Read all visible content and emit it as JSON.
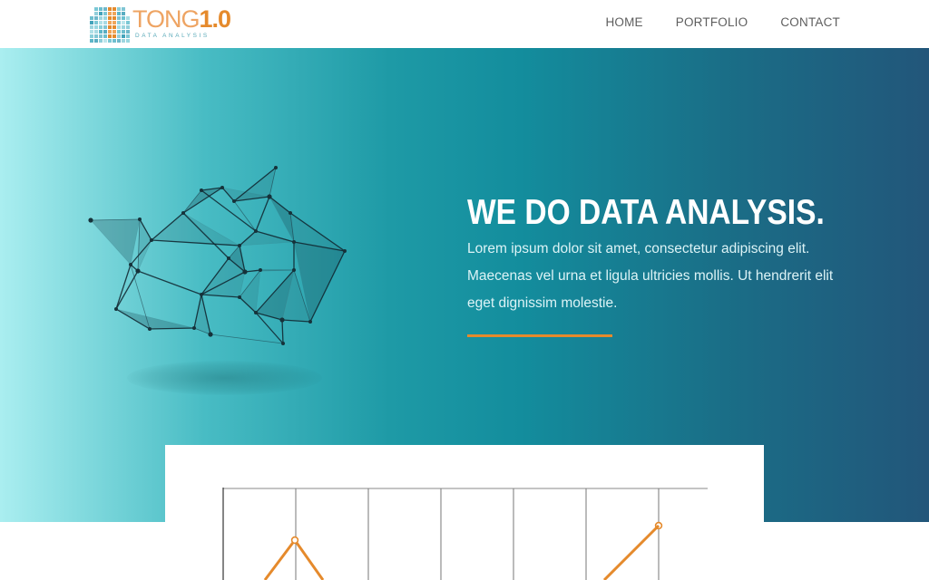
{
  "header": {
    "logo": {
      "brand_light": "TONG",
      "brand_bold": "1.0",
      "subtitle": "DATA ANALYSIS",
      "icon": "grid-bars-logo-icon"
    },
    "nav": [
      {
        "label": "HOME"
      },
      {
        "label": "PORTFOLIO"
      },
      {
        "label": "CONTACT"
      }
    ]
  },
  "hero": {
    "headline": "WE DO DATA ANALYSIS.",
    "description": "Lorem ipsum dolor sit amet, consectetur adipiscing elit. Maecenas vel urna et ligula ultricies mollis. Ut hendrerit elit eget dignissim molestie.",
    "illustration": "network-graph-icon"
  },
  "colors": {
    "accent": "#e58a2c",
    "hero_gradient_start": "#aaeef0",
    "hero_gradient_mid": "#138d9d",
    "hero_gradient_end": "#22567a",
    "nav_text": "#5e5e5e",
    "grid_line": "#555555"
  }
}
